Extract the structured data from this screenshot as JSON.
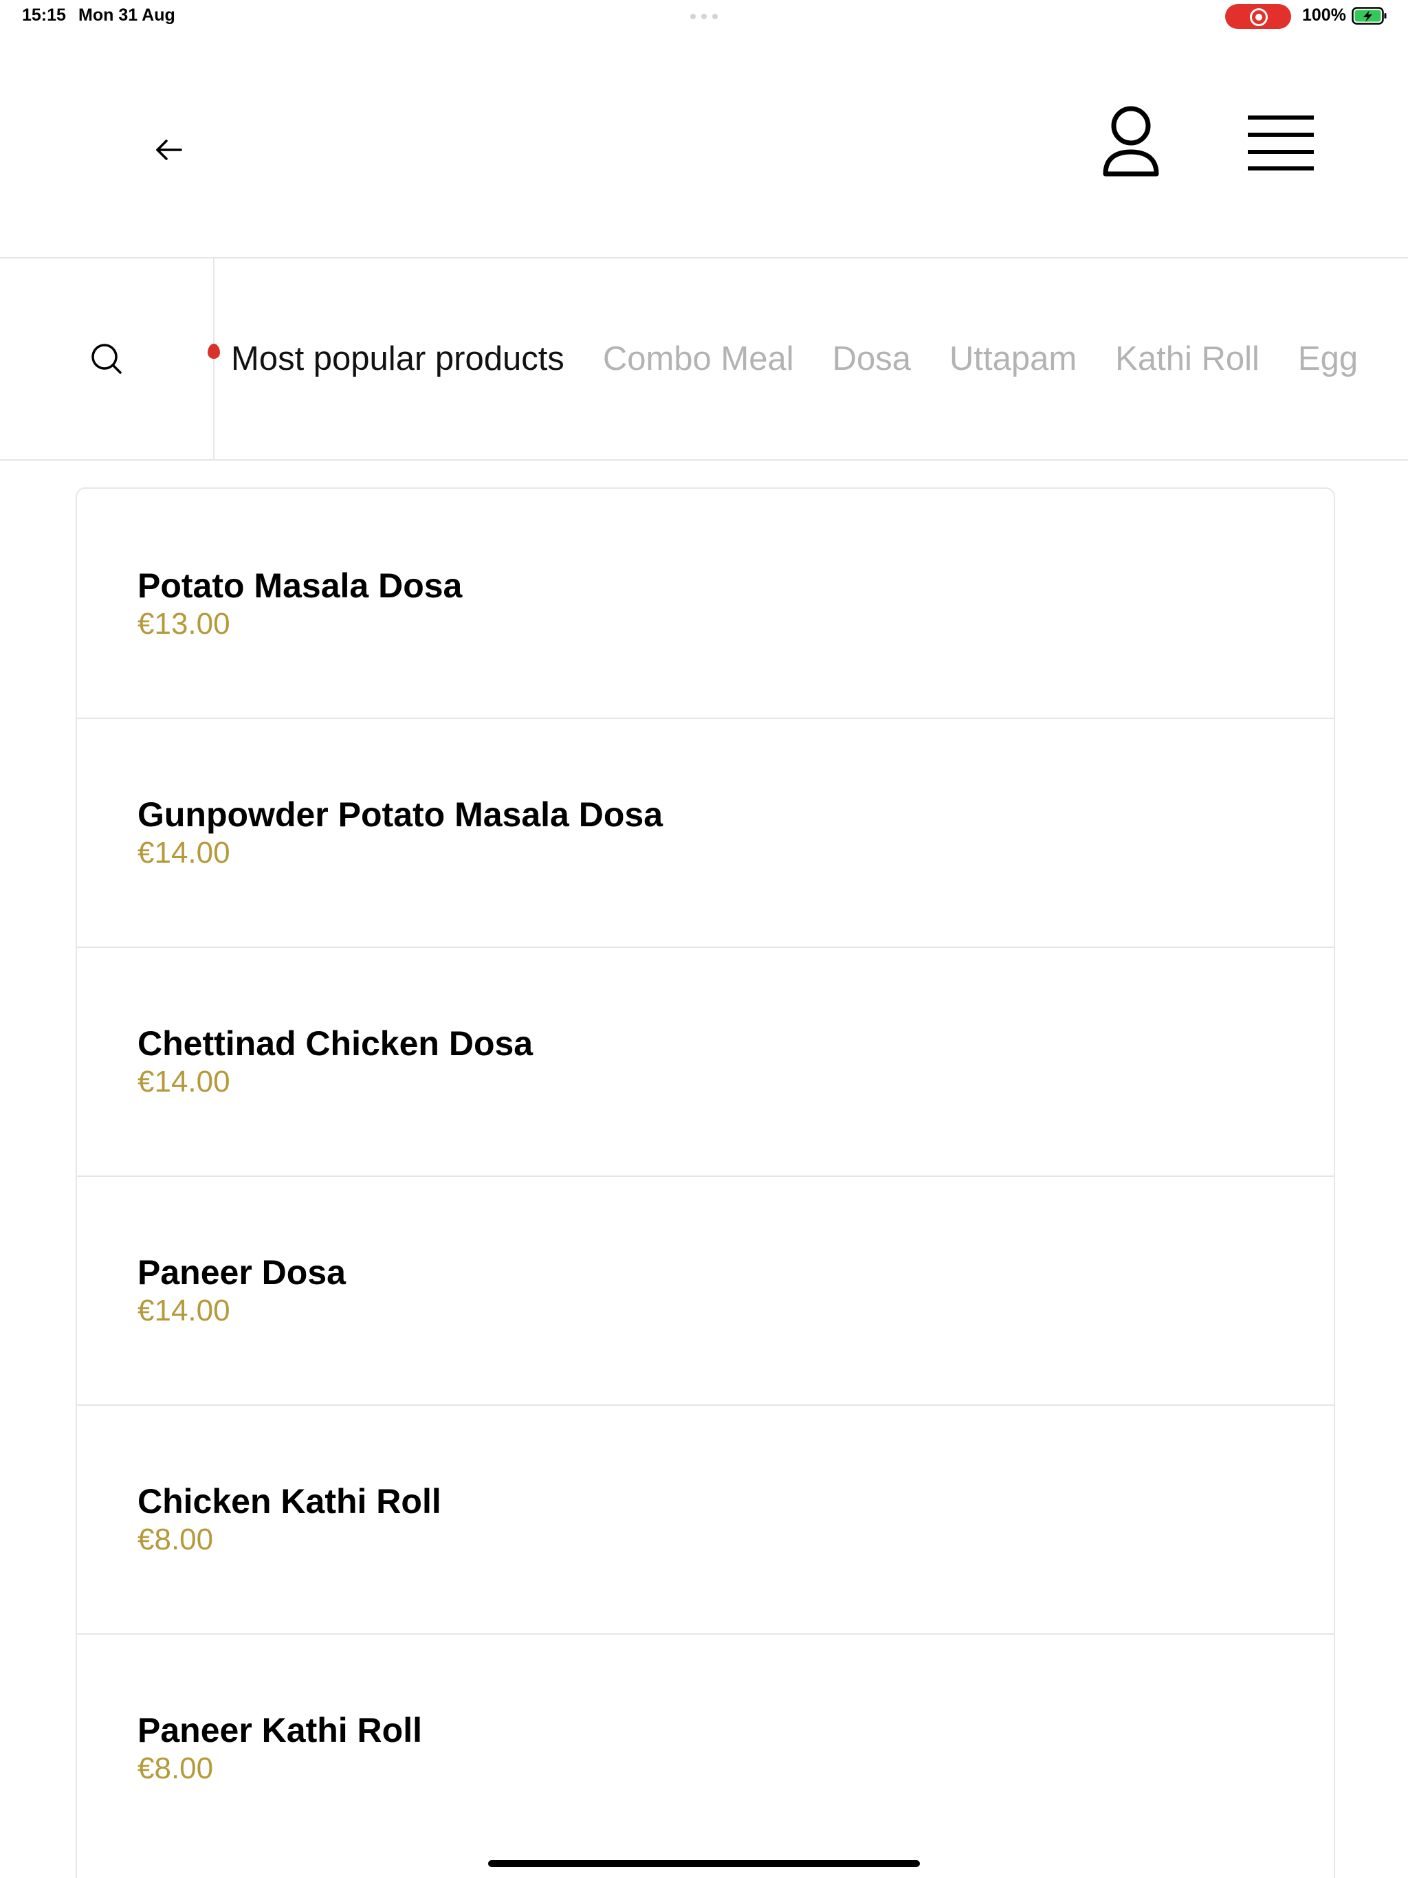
{
  "status_bar": {
    "time": "15:15",
    "date": "Mon 31 Aug",
    "battery": "100%",
    "record_color": "#e2302a",
    "battery_fill_color": "#34c759"
  },
  "header": {
    "back_icon": "arrow-left-icon",
    "account_icon": "user-icon",
    "menu_icon": "hamburger-menu-icon"
  },
  "categories": {
    "search_icon": "search-icon",
    "tabs": [
      {
        "label": "Most popular products",
        "active": true
      },
      {
        "label": "Combo Meal",
        "active": false
      },
      {
        "label": "Dosa",
        "active": false
      },
      {
        "label": "Uttapam",
        "active": false
      },
      {
        "label": "Kathi Roll",
        "active": false
      },
      {
        "label": "Egg",
        "active": false
      }
    ]
  },
  "products": [
    {
      "name": "Potato Masala Dosa",
      "price": "€13.00"
    },
    {
      "name": "Gunpowder Potato Masala Dosa",
      "price": "€14.00"
    },
    {
      "name": "Chettinad Chicken Dosa",
      "price": "€14.00"
    },
    {
      "name": "Paneer Dosa",
      "price": "€14.00"
    },
    {
      "name": "Chicken Kathi Roll",
      "price": "€8.00"
    },
    {
      "name": "Paneer Kathi Roll",
      "price": "€8.00"
    }
  ],
  "colors": {
    "price": "#b59a3c",
    "inactive_tab": "#b3b3b3",
    "divider": "#e6e6e6",
    "accent_marker": "#d8322b"
  }
}
